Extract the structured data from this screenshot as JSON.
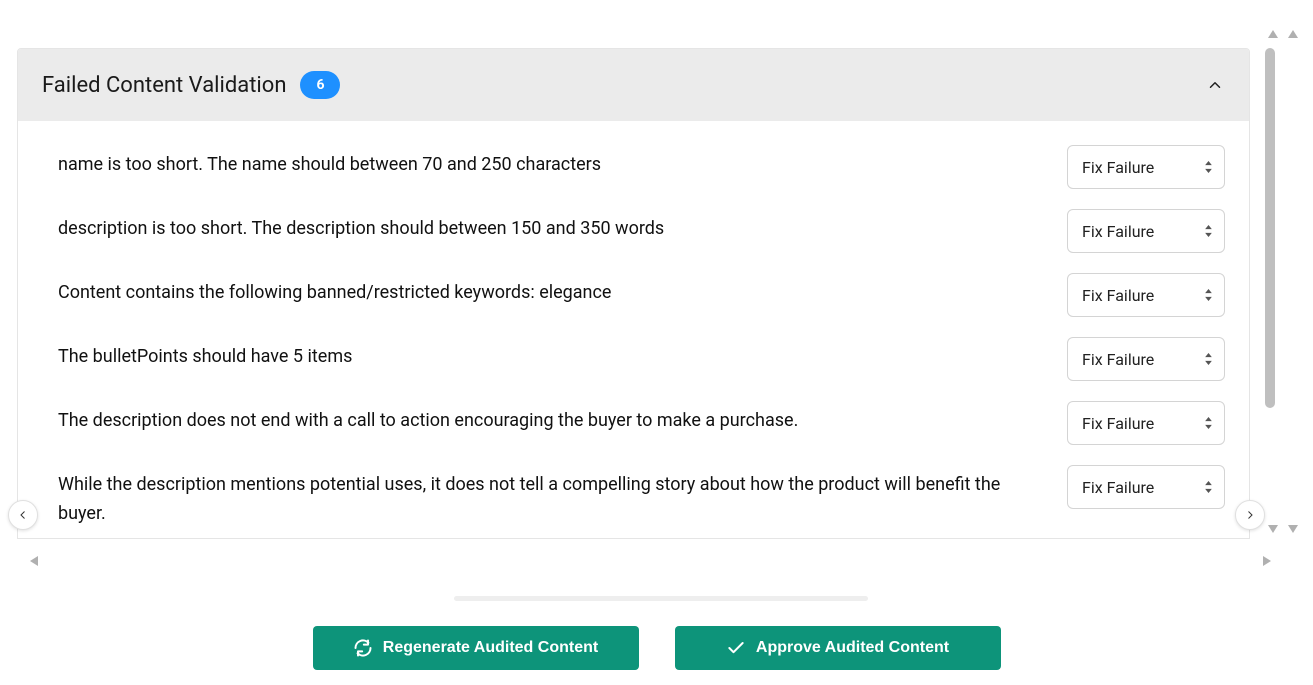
{
  "panel": {
    "title": "Failed Content Validation",
    "count": "6",
    "fix_label": "Fix Failure",
    "failures": [
      "name is too short. The name should between 70 and 250 characters",
      "description is too short. The description should between 150 and 350 words",
      "Content contains the following banned/restricted keywords: elegance",
      "The bulletPoints should have 5 items",
      "The description does not end with a call to action encouraging the buyer to make a purchase.",
      "While the description mentions potential uses, it does not tell a compelling story about how the product will benefit the buyer."
    ]
  },
  "actions": {
    "regenerate": "Regenerate Audited Content",
    "approve": "Approve Audited Content"
  }
}
